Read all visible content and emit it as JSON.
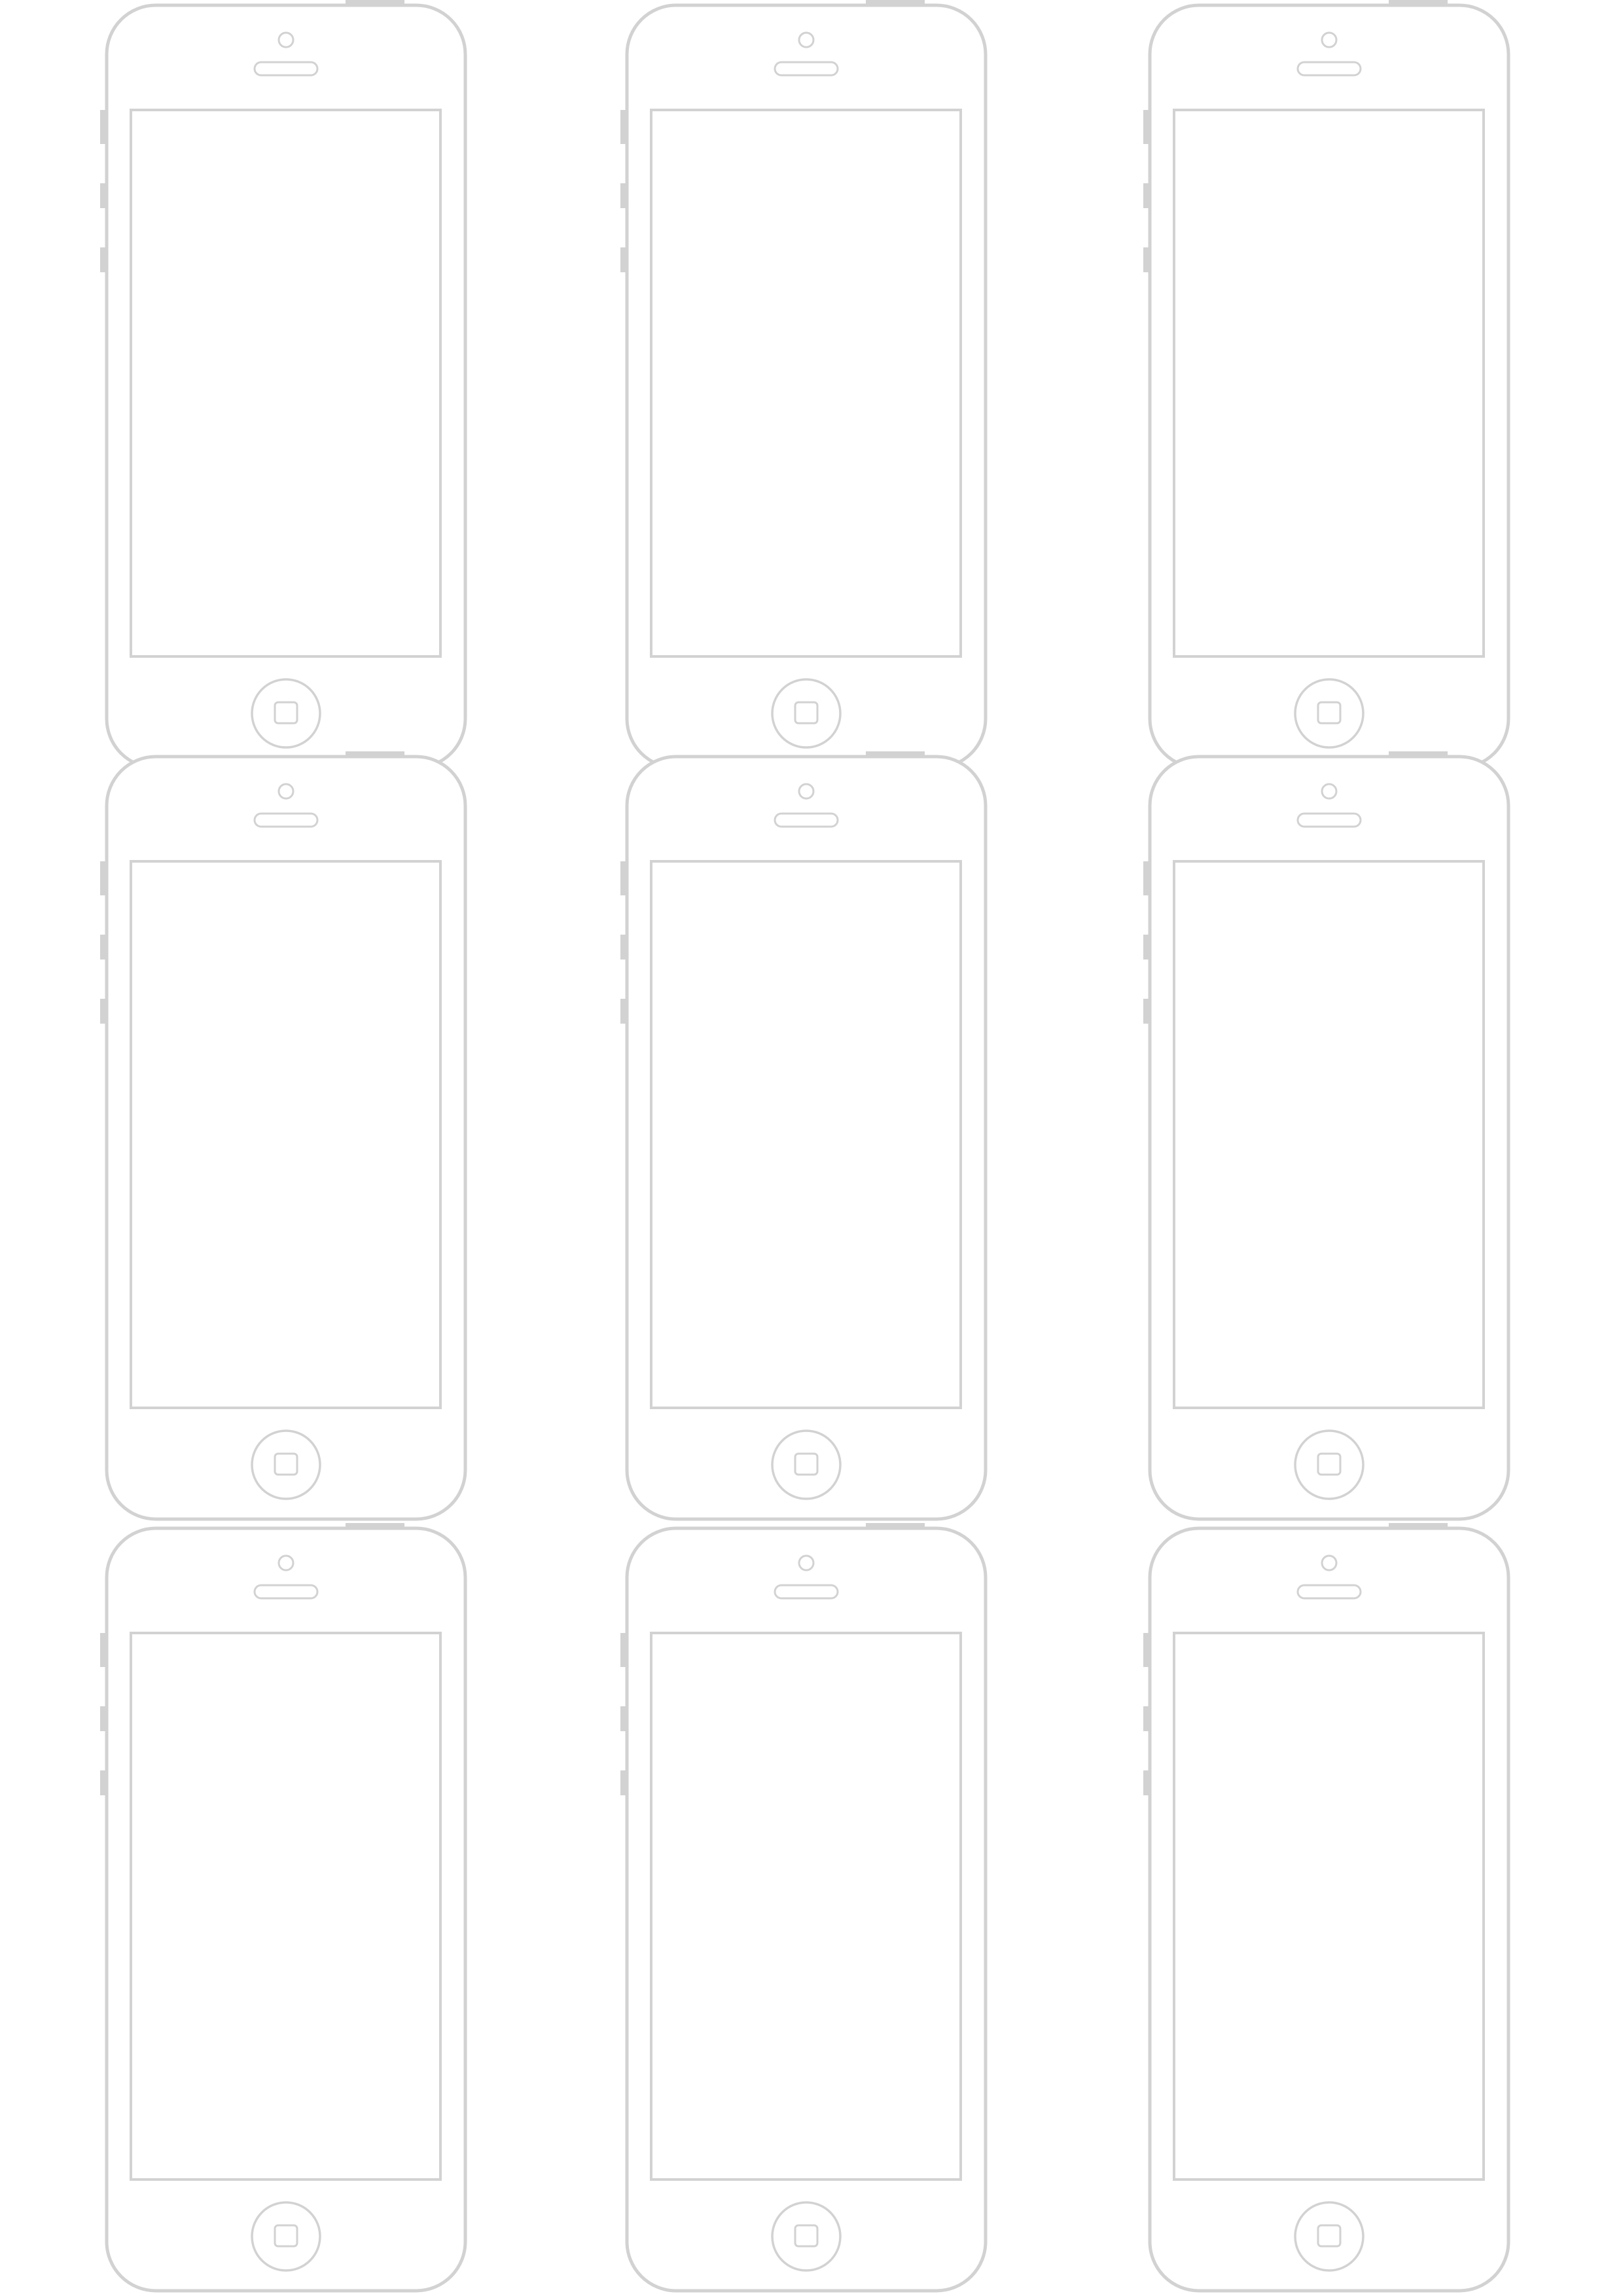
{
  "template": {
    "type": "phone-wireframe-sheet",
    "device": "smartphone-outline",
    "rows": 3,
    "columns": 3,
    "count": 9,
    "outline_color": "#d2d2d2",
    "background_color": "#ffffff"
  }
}
